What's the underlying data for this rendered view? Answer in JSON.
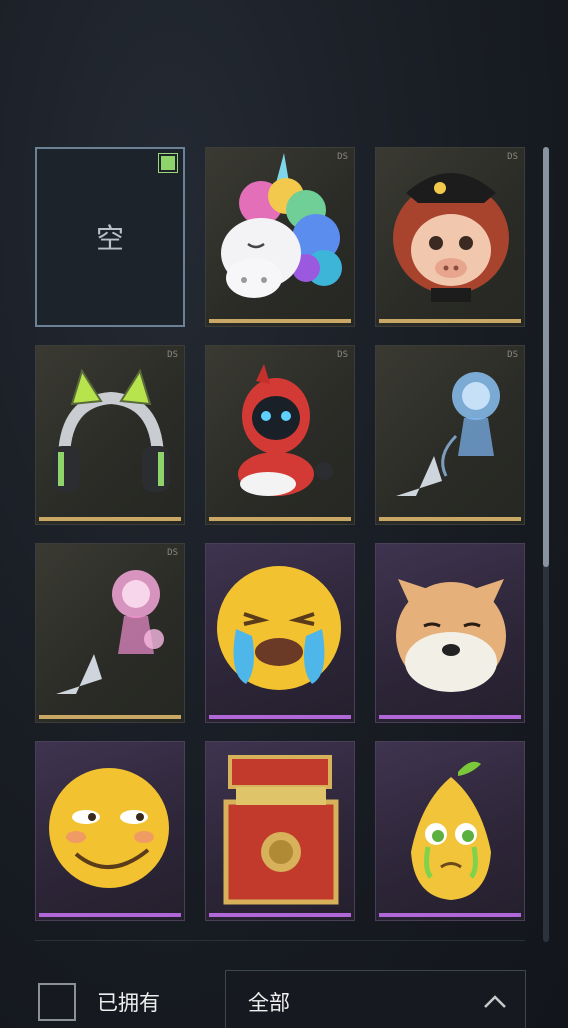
{
  "grid": {
    "slots": [
      {
        "kind": "empty",
        "label": "空",
        "selected_marker": true
      },
      {
        "kind": "gold",
        "icon": "rainbow-unicorn-head-icon",
        "tag": "DS"
      },
      {
        "kind": "gold",
        "icon": "pirate-pig-girl-head-icon",
        "tag": "DS"
      },
      {
        "kind": "gold",
        "icon": "cat-ear-headphones-icon",
        "tag": "DS"
      },
      {
        "kind": "gold",
        "icon": "red-robot-bot-icon",
        "tag": "DS"
      },
      {
        "kind": "gold",
        "icon": "blue-hologram-sprite-icon",
        "tag": "DS"
      },
      {
        "kind": "gold",
        "icon": "pink-hologram-sprite-icon",
        "tag": "DS"
      },
      {
        "kind": "purple",
        "icon": "crying-emoji-face-icon",
        "tag": ""
      },
      {
        "kind": "purple",
        "icon": "shiba-doge-face-icon",
        "tag": ""
      },
      {
        "kind": "purple",
        "icon": "smirk-emoji-face-icon",
        "tag": ""
      },
      {
        "kind": "purple",
        "icon": "red-treasure-chest-icon",
        "tag": ""
      },
      {
        "kind": "purple",
        "icon": "crying-pear-icon",
        "tag": ""
      }
    ]
  },
  "footer": {
    "owned_label": "已拥有",
    "owned_checked": false,
    "filter_label": "全部"
  },
  "colors": {
    "gold_rarity": "#c9a866",
    "purple_rarity": "#b068d8",
    "selected_marker": "#8fd46a"
  }
}
